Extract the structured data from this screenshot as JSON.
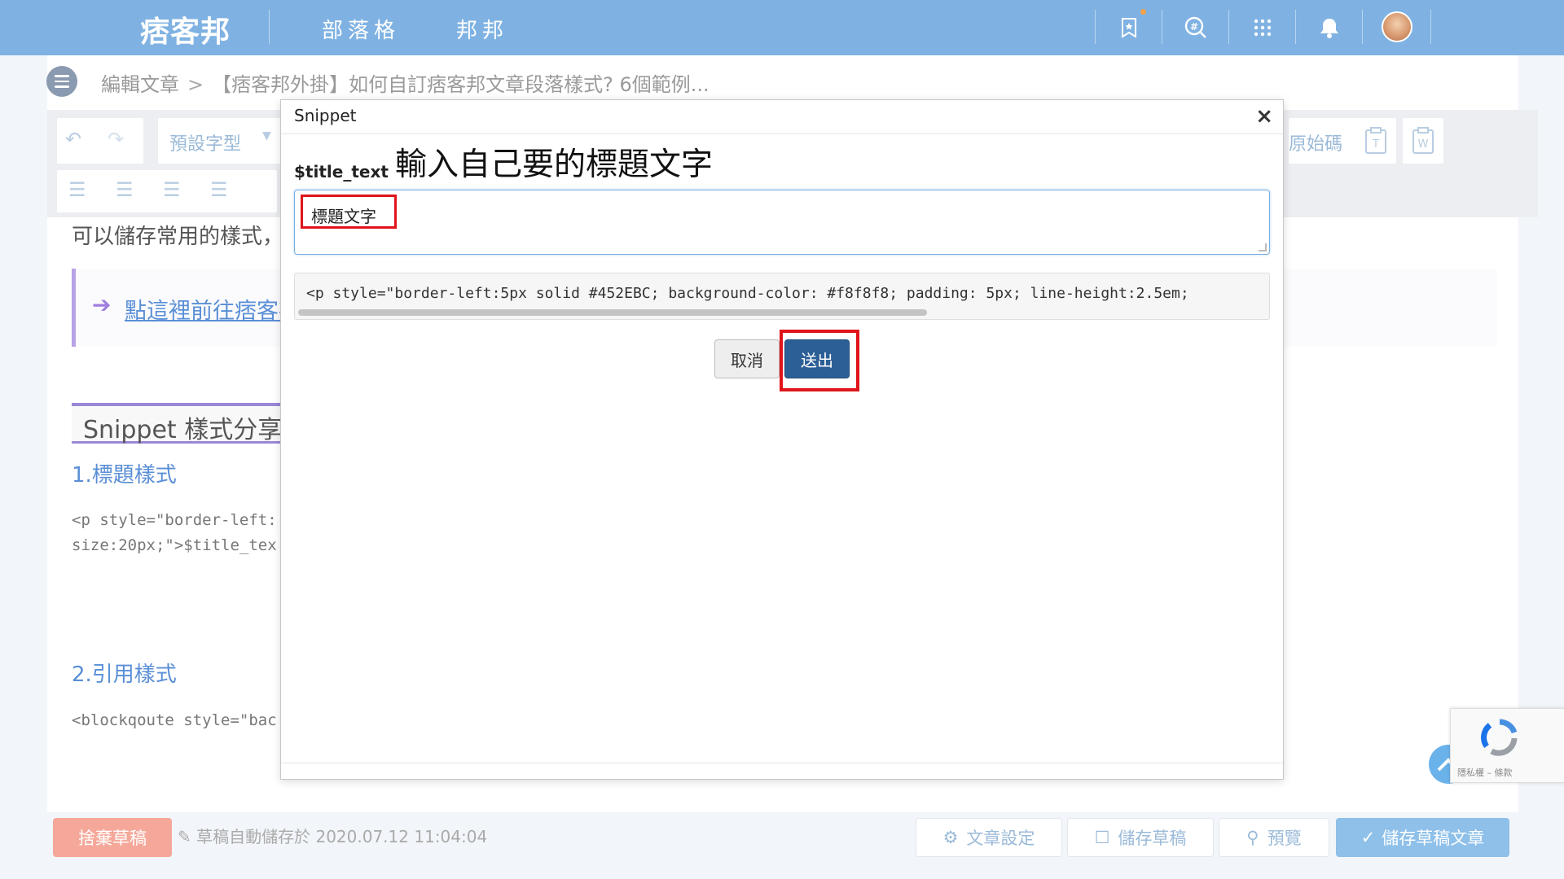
{
  "nav": {
    "logo": "痞客邦",
    "links": [
      "部落格",
      "邦邦"
    ],
    "icons": [
      "bookmark-star-icon",
      "hashtag-search-icon",
      "apps-grid-icon",
      "bell-icon"
    ]
  },
  "breadcrumb": {
    "parent": "編輯文章",
    "sep": ">",
    "current": "【痞客邦外掛】如何自訂痞客邦文章段落樣式? 6個範例..."
  },
  "toolbar": {
    "font_select": "預設字型",
    "source_label": "原始碼"
  },
  "article": {
    "intro": "可以儲存常用的樣式，",
    "quote_link": "點這裡前往痞客邦",
    "h2": "Snippet 樣式分享",
    "sections": [
      {
        "title": "1.標題樣式",
        "code": [
          "<p style=\"border-left:",
          "size:20px;\">$title_tex"
        ]
      },
      {
        "title": "2.引用樣式",
        "code": [
          "<blockqoute style=\"bac"
        ]
      }
    ]
  },
  "modal": {
    "title": "Snippet",
    "close": "×",
    "field_label": "$title_text",
    "annotation": "輸入自己要的標題文字",
    "field_value": "標題文字",
    "preview_code": "<p style=\"border-left:5px solid #452EBC; background-color: #f8f8f8; padding: 5px; line-height:2.5em;",
    "cancel_label": "取消",
    "submit_label": "送出"
  },
  "footer": {
    "discard_label": "捨棄草稿",
    "autosave_text": "草稿自動儲存於 2020.07.12 11:04:04",
    "settings_label": "文章設定",
    "save_draft_label": "儲存草稿",
    "preview_label": "預覽",
    "publish_label": "儲存草稿文章"
  },
  "recaptcha": {
    "text": "隱私權 – 條款"
  },
  "colors": {
    "nav_bg": "#7fb2e2",
    "primary_button": "#2c5f96",
    "annotation_red": "#e0141b",
    "accent_purple": "#9b87d8",
    "link_blue": "#5a8fd6"
  }
}
